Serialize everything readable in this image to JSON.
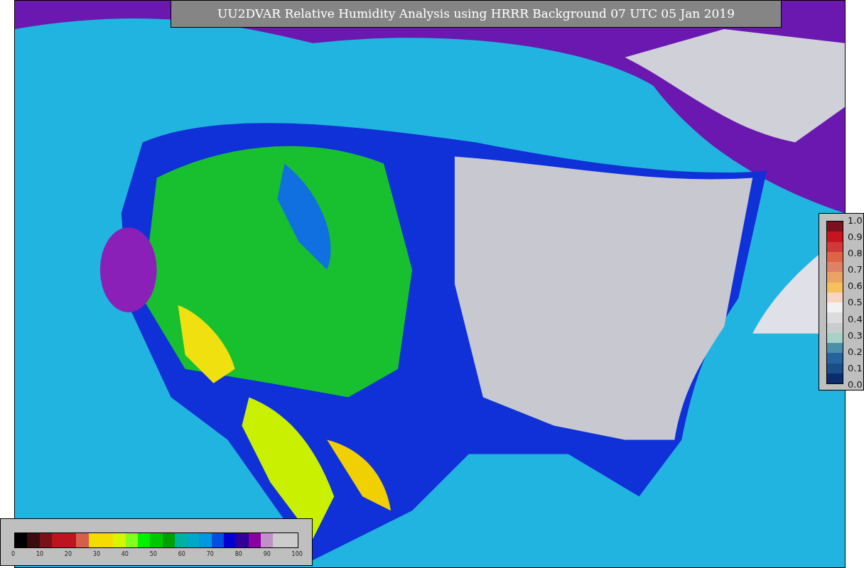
{
  "title": "UU2DVAR Relative Humidity Analysis using HRRR Background 07 UTC 05 Jan 2019",
  "humidity_colorbar": {
    "segments": [
      {
        "color": "#000000"
      },
      {
        "color": "#3a0a0e"
      },
      {
        "color": "#7a1018"
      },
      {
        "color": "#bd1520"
      },
      {
        "color": "#bd1520"
      },
      {
        "color": "#d4604a"
      },
      {
        "color": "#f5dc00"
      },
      {
        "color": "#f5dc00"
      },
      {
        "color": "#d8f500"
      },
      {
        "color": "#80ff20"
      },
      {
        "color": "#00f000"
      },
      {
        "color": "#00c800"
      },
      {
        "color": "#00a000"
      },
      {
        "color": "#00b0a0"
      },
      {
        "color": "#00a8c8"
      },
      {
        "color": "#0098e0"
      },
      {
        "color": "#0050e0"
      },
      {
        "color": "#0000d0"
      },
      {
        "color": "#30009a"
      },
      {
        "color": "#8a00a0"
      },
      {
        "color": "#c090c8"
      },
      {
        "color": "#cccccc"
      },
      {
        "color": "#cccccc"
      }
    ],
    "ticks": [
      "0",
      "10",
      "20",
      "30",
      "40",
      "50",
      "60",
      "70",
      "80",
      "90",
      "100"
    ]
  },
  "obs_colorbar": {
    "segments": [
      {
        "color": "#7a1020"
      },
      {
        "color": "#c8141e"
      },
      {
        "color": "#cf3a36"
      },
      {
        "color": "#df6446"
      },
      {
        "color": "#e08266"
      },
      {
        "color": "#eba265"
      },
      {
        "color": "#f6c05c"
      },
      {
        "color": "#f7d3c1"
      },
      {
        "color": "#f1f1f2"
      },
      {
        "color": "#dcdcdc"
      },
      {
        "color": "#c8cdd0"
      },
      {
        "color": "#a6d3c6"
      },
      {
        "color": "#4b8fab"
      },
      {
        "color": "#2563a0"
      },
      {
        "color": "#1a4e88"
      },
      {
        "color": "#0b2d70"
      }
    ],
    "ticks": [
      "1.0",
      "0.9",
      "0.8",
      "0.7",
      "0.6",
      "0.5",
      "0.4",
      "0.3",
      "0.2",
      "0.1",
      "0.0"
    ]
  }
}
